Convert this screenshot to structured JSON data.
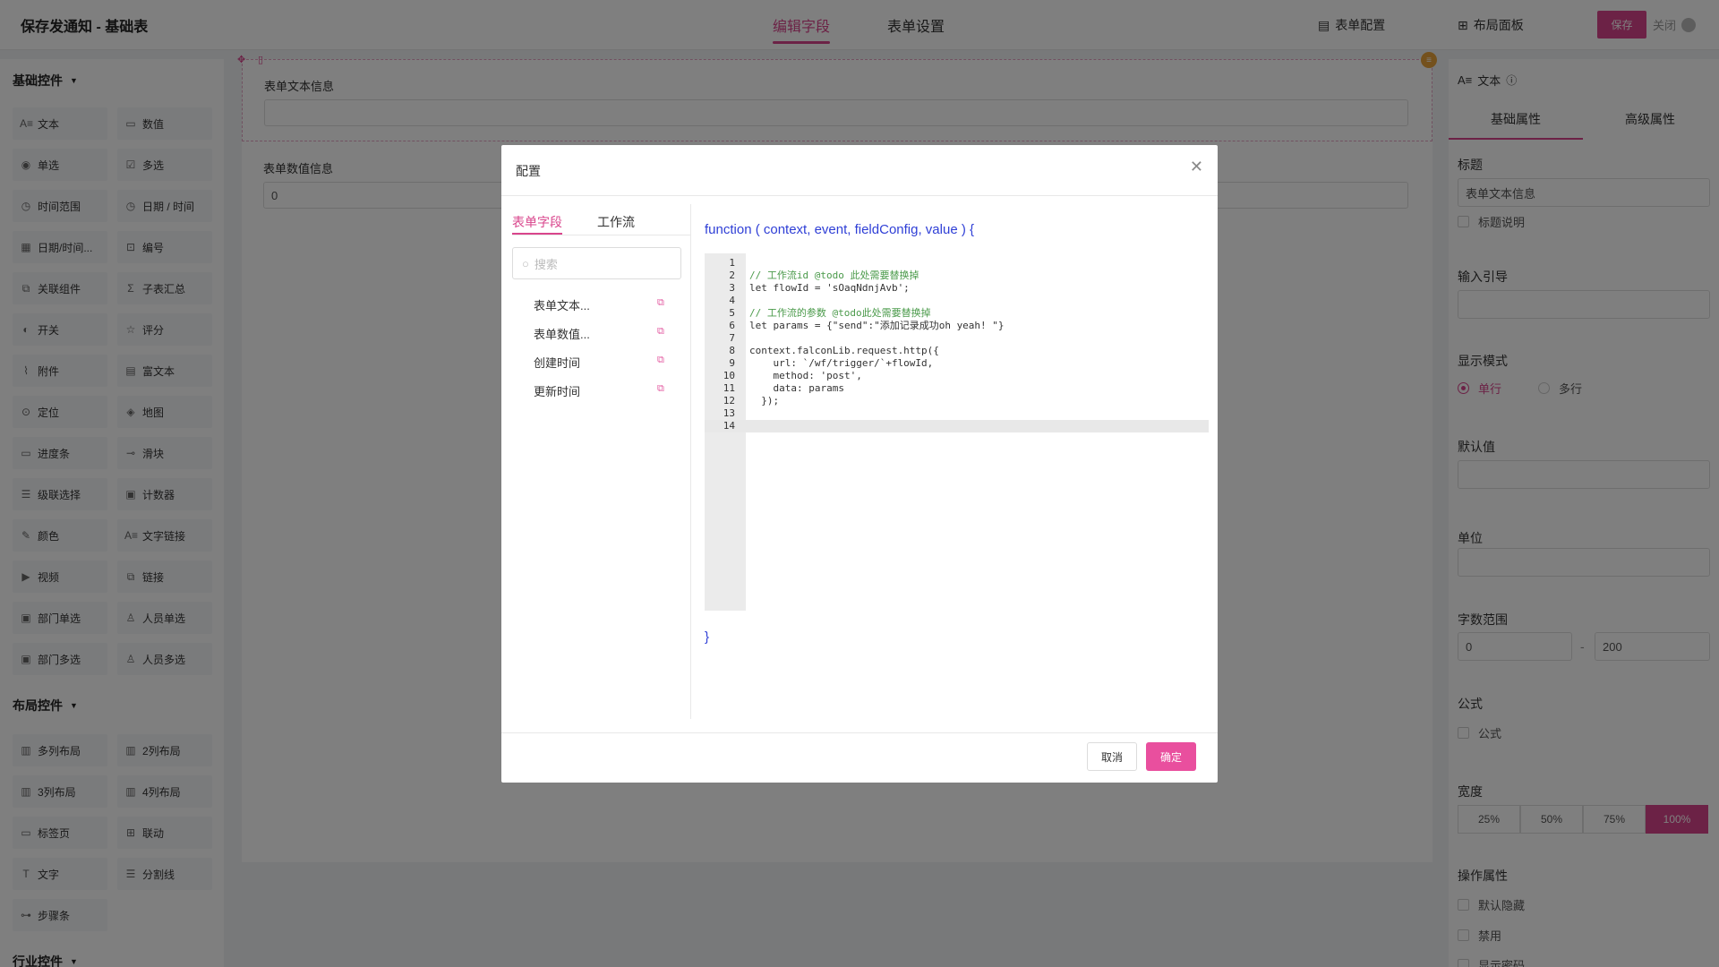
{
  "header": {
    "title": "保存发通知 - 基础表",
    "tabs": [
      {
        "label": "编辑字段",
        "active": true
      },
      {
        "label": "表单设置",
        "active": false
      }
    ],
    "form_config_label": "表单配置",
    "layout_panel_label": "布局面板",
    "save_label": "保存",
    "close_label": "关闭"
  },
  "palette": {
    "basic_title": "基础控件",
    "basic_items": [
      {
        "label": "文本",
        "icon": "text-icon"
      },
      {
        "label": "数值",
        "icon": "number-icon"
      },
      {
        "label": "单选",
        "icon": "radio-icon"
      },
      {
        "label": "多选",
        "icon": "checkbox-icon"
      },
      {
        "label": "时间范围",
        "icon": "clock-icon"
      },
      {
        "label": "日期 / 时间",
        "icon": "clock-icon"
      },
      {
        "label": "日期/时间...",
        "icon": "calendar-icon"
      },
      {
        "label": "编号",
        "icon": "tag-icon"
      },
      {
        "label": "关联组件",
        "icon": "link-icon"
      },
      {
        "label": "子表汇总",
        "icon": "sigma-icon"
      },
      {
        "label": "开关",
        "icon": "toggle-icon"
      },
      {
        "label": "评分",
        "icon": "star-icon"
      },
      {
        "label": "附件",
        "icon": "paperclip-icon"
      },
      {
        "label": "富文本",
        "icon": "document-icon"
      },
      {
        "label": "定位",
        "icon": "location-icon"
      },
      {
        "label": "地图",
        "icon": "map-icon"
      },
      {
        "label": "进度条",
        "icon": "progress-icon"
      },
      {
        "label": "滑块",
        "icon": "slider-icon"
      },
      {
        "label": "级联选择",
        "icon": "cascade-icon"
      },
      {
        "label": "计数器",
        "icon": "counter-icon"
      },
      {
        "label": "颜色",
        "icon": "eyedropper-icon"
      },
      {
        "label": "文字链接",
        "icon": "text-link-icon"
      },
      {
        "label": "视频",
        "icon": "video-icon"
      },
      {
        "label": "链接",
        "icon": "link-icon"
      },
      {
        "label": "部门单选",
        "icon": "department-icon"
      },
      {
        "label": "人员单选",
        "icon": "user-icon"
      },
      {
        "label": "部门多选",
        "icon": "department-icon"
      },
      {
        "label": "人员多选",
        "icon": "users-icon"
      }
    ],
    "layout_title": "布局控件",
    "layout_items": [
      {
        "label": "多列布局",
        "icon": "columns-icon"
      },
      {
        "label": "2列布局",
        "icon": "columns-icon"
      },
      {
        "label": "3列布局",
        "icon": "columns-icon"
      },
      {
        "label": "4列布局",
        "icon": "columns-icon"
      },
      {
        "label": "标签页",
        "icon": "tabs-icon"
      },
      {
        "label": "联动",
        "icon": "grid-icon"
      },
      {
        "label": "文字",
        "icon": "text-t-icon"
      },
      {
        "label": "分割线",
        "icon": "divider-icon"
      },
      {
        "label": "步骤条",
        "icon": "steps-icon"
      }
    ],
    "industry_title": "行业控件"
  },
  "canvas": {
    "field1_label": "表单文本信息",
    "field1_value": "",
    "field2_label": "表单数值信息",
    "field2_value": "0"
  },
  "props": {
    "title": "文本",
    "tabs": [
      "基础属性",
      "高级属性"
    ],
    "title_label": "标题",
    "title_value": "表单文本信息",
    "title_desc": "标题说明",
    "input_guide_label": "输入引导",
    "display_mode_label": "显示模式",
    "display_modes": [
      "单行",
      "多行"
    ],
    "default_label": "默认值",
    "unit_label": "单位",
    "char_range_label": "字数范围",
    "char_min": "0",
    "char_sep": "-",
    "char_max": "200",
    "formula_label": "公式",
    "formula_check": "公式",
    "width_label": "宽度",
    "widths": [
      "25%",
      "50%",
      "75%",
      "100%"
    ],
    "ops_label": "操作属性",
    "ops": [
      "默认隐藏",
      "禁用",
      "显示密码"
    ]
  },
  "modal": {
    "title": "配置",
    "tabs": [
      "表单字段",
      "工作流"
    ],
    "search_placeholder": "搜索",
    "fields": [
      "表单文本...",
      "表单数值...",
      "创建时间",
      "更新时间"
    ],
    "function_signature": "function ( context, event, fieldConfig, value ) {",
    "function_end": "}",
    "code_lines": [
      {
        "n": "1",
        "text": ""
      },
      {
        "n": "2",
        "text": "// 工作流id @todo 此处需要替换掉"
      },
      {
        "n": "3",
        "text": "let flowId = 'sOaqNdnjAvb';"
      },
      {
        "n": "4",
        "text": ""
      },
      {
        "n": "5",
        "text": "// 工作流的参数 @todo此处需要替换掉"
      },
      {
        "n": "6",
        "text": "let params = {\"send\":\"添加记录成功oh yeah! \"}"
      },
      {
        "n": "7",
        "text": ""
      },
      {
        "n": "8",
        "text": "context.falconLib.request.http({"
      },
      {
        "n": "9",
        "text": "    url: `/wf/trigger/`+flowId,"
      },
      {
        "n": "10",
        "text": "    method: 'post',"
      },
      {
        "n": "11",
        "text": "    data: params"
      },
      {
        "n": "12",
        "text": "  });"
      },
      {
        "n": "13",
        "text": ""
      },
      {
        "n": "14",
        "text": ""
      }
    ],
    "cancel_label": "取消",
    "ok_label": "确定"
  },
  "colors": {
    "accent": "#d9458c",
    "code_keyword": "#2f3fd6",
    "code_comment": "#4a9a4a"
  }
}
